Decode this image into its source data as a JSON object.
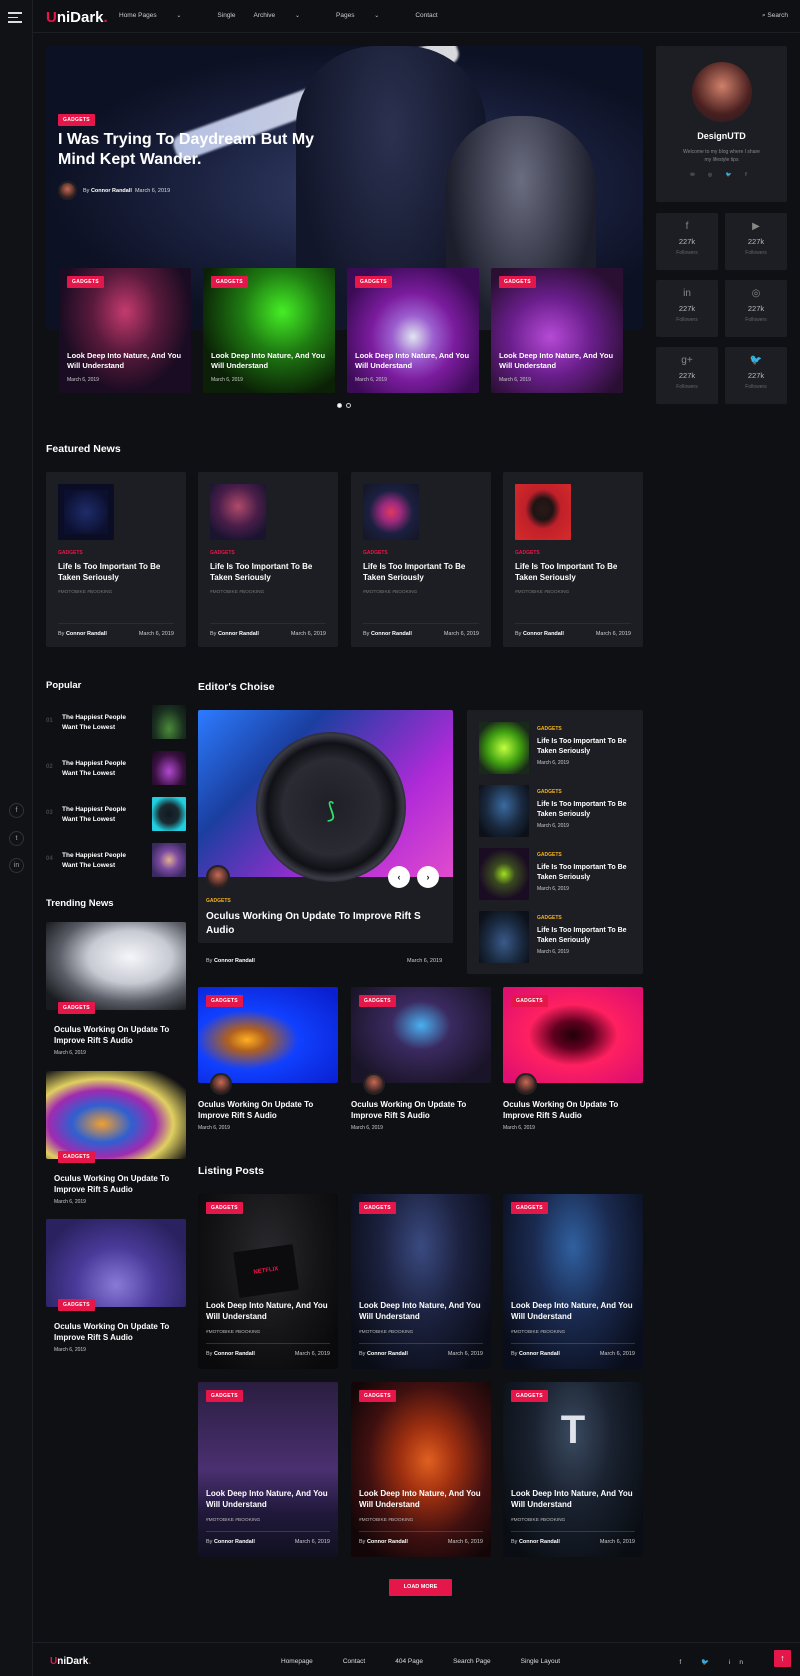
{
  "brand": {
    "name_first": "U",
    "name_rest": "niDark",
    "dot": ".",
    "accent": "#e5174a"
  },
  "nav": [
    {
      "label": "Home Pages",
      "chevron": "⌄"
    },
    {
      "label": "Single",
      "chevron": ""
    },
    {
      "label": "Archive",
      "chevron": "⌄"
    },
    {
      "label": "Pages",
      "chevron": "⌄"
    },
    {
      "label": "Contact",
      "chevron": ""
    }
  ],
  "search": {
    "label": "Search",
    "icon": "search-icon"
  },
  "rail_social": [
    "f",
    "t",
    "in"
  ],
  "hero": {
    "tag": "GADGETS",
    "title": "I Was Trying To Daydream But My Mind Kept Wander.",
    "by": "By",
    "author": "Connor Randall",
    "date": "March 6, 2019"
  },
  "slides": [
    {
      "tag": "GADGETS",
      "title": "Look Deep Into Nature, And You Will Understand",
      "date": "March 6, 2019"
    },
    {
      "tag": "GADGETS",
      "title": "Look Deep Into Nature, And You Will Understand",
      "date": "March 6, 2019"
    },
    {
      "tag": "GADGETS",
      "title": "Look Deep Into Nature, And You Will Understand",
      "date": "March 6, 2019"
    },
    {
      "tag": "GADGETS",
      "title": "Look Deep Into Nature, And You Will Understand",
      "date": "March 6, 2019"
    }
  ],
  "profile": {
    "name": "DesignUTD",
    "desc": "Welcome to my blog where I share my lifestyle tips",
    "icons": "✉ ◎ 🐦 f"
  },
  "stats": [
    {
      "icon": "f",
      "value": "227k",
      "label": "Followers"
    },
    {
      "icon": "▶",
      "value": "227k",
      "label": "Followers"
    },
    {
      "icon": "in",
      "value": "227k",
      "label": "Followers"
    },
    {
      "icon": "◎",
      "value": "227k",
      "label": "Followers"
    },
    {
      "icon": "g+",
      "value": "227k",
      "label": "Followers"
    },
    {
      "icon": "🐦",
      "value": "227k",
      "label": "Followers"
    }
  ],
  "featured": {
    "title": "Featured News",
    "items": [
      {
        "cat": "GADGETS",
        "title": "Life Is Too Important To Be Taken Seriously",
        "tags": "#MOTOBIKE    #BOOKING",
        "by": "By",
        "author": "Connor Randall",
        "date": "March 6, 2019"
      },
      {
        "cat": "GADGETS",
        "title": "Life Is Too Important To Be Taken Seriously",
        "tags": "#MOTOBIKE    #BOOKING",
        "by": "By",
        "author": "Connor Randall",
        "date": "March 6, 2019"
      },
      {
        "cat": "GADGETS",
        "title": "Life Is Too Important To Be Taken Seriously",
        "tags": "#MOTOBIKE    #BOOKING",
        "by": "By",
        "author": "Connor Randall",
        "date": "March 6, 2019"
      },
      {
        "cat": "GADGETS",
        "title": "Life Is Too Important To Be Taken Seriously",
        "tags": "#MOTOBIKE    #BOOKING",
        "by": "By",
        "author": "Connor Randall",
        "date": "March 6, 2019"
      }
    ]
  },
  "popular": {
    "title": "Popular",
    "items": [
      {
        "num": "01",
        "title": "The Happiest People Want The Lowest"
      },
      {
        "num": "02",
        "title": "The Happiest People Want The Lowest"
      },
      {
        "num": "03",
        "title": "The Happiest People Want The Lowest"
      },
      {
        "num": "04",
        "title": "The Happiest People Want The Lowest"
      }
    ]
  },
  "trending": {
    "title": "Trending News",
    "items": [
      {
        "tag": "GADGETS",
        "title": "Oculus Working On Update To Improve Rift S Audio",
        "date": "March 6, 2019"
      },
      {
        "tag": "GADGETS",
        "title": "Oculus Working On Update To Improve Rift S Audio",
        "date": "March 6, 2019"
      },
      {
        "tag": "GADGETS",
        "title": "Oculus Working On Update To Improve Rift S Audio",
        "date": "March 6, 2019"
      }
    ]
  },
  "editor": {
    "title": "Editor's Choise",
    "main": {
      "cat": "GADGETS",
      "title": "Oculus Working On Update To Improve Rift S Audio",
      "by": "By",
      "author": "Connor Randall",
      "date": "March 6, 2019"
    },
    "prev": "‹",
    "next": "›",
    "list": [
      {
        "cat": "GADGETS",
        "title": "Life Is Too Important To Be Taken Seriously",
        "date": "March 6, 2019"
      },
      {
        "cat": "GADGETS",
        "title": "Life Is Too Important To Be Taken Seriously",
        "date": "March 6, 2019"
      },
      {
        "cat": "GADGETS",
        "title": "Life Is Too Important To Be Taken Seriously",
        "date": "March 6, 2019"
      },
      {
        "cat": "GADGETS",
        "title": "Life Is Too Important To Be Taken Seriously",
        "date": "March 6, 2019"
      }
    ],
    "grid": [
      {
        "tag": "GADGETS",
        "title": "Oculus Working On Update To Improve Rift S Audio",
        "date": "March 6, 2019"
      },
      {
        "tag": "GADGETS",
        "title": "Oculus Working On Update To Improve Rift S Audio",
        "date": "March 6, 2019"
      },
      {
        "tag": "GADGETS",
        "title": "Oculus Working On Update To Improve Rift S Audio",
        "date": "March 6, 2019"
      }
    ]
  },
  "listing": {
    "title": "Listing Posts",
    "items": [
      {
        "tag": "GADGETS",
        "title": "Look Deep Into Nature, And You Will Understand",
        "tags": "#MOTOBIKE    #BOOKING",
        "by": "By",
        "author": "Connor Randall",
        "date": "March 6, 2019"
      },
      {
        "tag": "GADGETS",
        "title": "Look Deep Into Nature, And You Will Understand",
        "tags": "#MOTOBIKE    #BOOKING",
        "by": "By",
        "author": "Connor Randall",
        "date": "March 6, 2019"
      },
      {
        "tag": "GADGETS",
        "title": "Look Deep Into Nature, And You Will Understand",
        "tags": "#MOTOBIKE    #BOOKING",
        "by": "By",
        "author": "Connor Randall",
        "date": "March 6, 2019"
      },
      {
        "tag": "GADGETS",
        "title": "Look Deep Into Nature, And You Will Understand",
        "tags": "#MOTOBIKE    #BOOKING",
        "by": "By",
        "author": "Connor Randall",
        "date": "March 6, 2019"
      },
      {
        "tag": "GADGETS",
        "title": "Look Deep Into Nature, And You Will Understand",
        "tags": "#MOTOBIKE    #BOOKING",
        "by": "By",
        "author": "Connor Randall",
        "date": "March 6, 2019"
      },
      {
        "tag": "GADGETS",
        "title": "Look Deep Into Nature, And You Will Understand",
        "tags": "#MOTOBIKE    #BOOKING",
        "by": "By",
        "author": "Connor Randall",
        "date": "March 6, 2019"
      }
    ],
    "load_more": "LOAD MORE",
    "netflix": "NETFLIX"
  },
  "footer": {
    "links": [
      "Homepage",
      "Contact",
      "404 Page",
      "Search Page",
      "Single Layout"
    ],
    "social": "f 🐦 in",
    "to_top": "↑"
  }
}
